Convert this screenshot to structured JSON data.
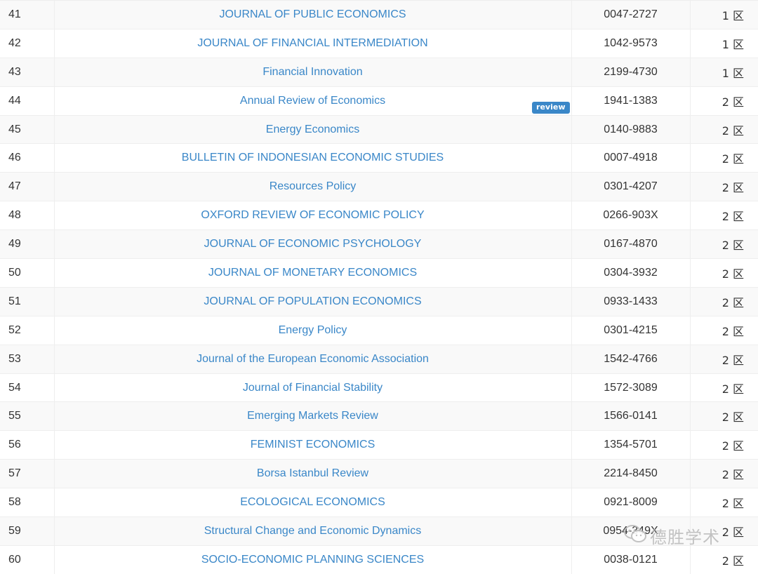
{
  "rows": [
    {
      "rank": "41",
      "name": "JOURNAL OF PUBLIC ECONOMICS",
      "issn": "0047-2727",
      "zone": "1 区"
    },
    {
      "rank": "42",
      "name": "JOURNAL OF FINANCIAL INTERMEDIATION",
      "issn": "1042-9573",
      "zone": "1 区"
    },
    {
      "rank": "43",
      "name": "Financial Innovation",
      "issn": "2199-4730",
      "zone": "1 区"
    },
    {
      "rank": "44",
      "name": "Annual Review of Economics",
      "issn": "1941-1383",
      "zone": "2 区",
      "badge": "review"
    },
    {
      "rank": "45",
      "name": "Energy Economics",
      "issn": "0140-9883",
      "zone": "2 区"
    },
    {
      "rank": "46",
      "name": "BULLETIN OF INDONESIAN ECONOMIC STUDIES",
      "issn": "0007-4918",
      "zone": "2 区"
    },
    {
      "rank": "47",
      "name": "Resources Policy",
      "issn": "0301-4207",
      "zone": "2 区"
    },
    {
      "rank": "48",
      "name": "OXFORD REVIEW OF ECONOMIC POLICY",
      "issn": "0266-903X",
      "zone": "2 区"
    },
    {
      "rank": "49",
      "name": "JOURNAL OF ECONOMIC PSYCHOLOGY",
      "issn": "0167-4870",
      "zone": "2 区"
    },
    {
      "rank": "50",
      "name": "JOURNAL OF MONETARY ECONOMICS",
      "issn": "0304-3932",
      "zone": "2 区"
    },
    {
      "rank": "51",
      "name": "JOURNAL OF POPULATION ECONOMICS",
      "issn": "0933-1433",
      "zone": "2 区"
    },
    {
      "rank": "52",
      "name": "Energy Policy",
      "issn": "0301-4215",
      "zone": "2 区"
    },
    {
      "rank": "53",
      "name": "Journal of the European Economic Association",
      "issn": "1542-4766",
      "zone": "2 区"
    },
    {
      "rank": "54",
      "name": "Journal of Financial Stability",
      "issn": "1572-3089",
      "zone": "2 区"
    },
    {
      "rank": "55",
      "name": "Emerging Markets Review",
      "issn": "1566-0141",
      "zone": "2 区"
    },
    {
      "rank": "56",
      "name": "FEMINIST ECONOMICS",
      "issn": "1354-5701",
      "zone": "2 区"
    },
    {
      "rank": "57",
      "name": "Borsa Istanbul Review",
      "issn": "2214-8450",
      "zone": "2 区"
    },
    {
      "rank": "58",
      "name": "ECOLOGICAL ECONOMICS",
      "issn": "0921-8009",
      "zone": "2 区"
    },
    {
      "rank": "59",
      "name": "Structural Change and Economic Dynamics",
      "issn": "0954-349X",
      "zone": "2 区"
    },
    {
      "rank": "60",
      "name": "SOCIO-ECONOMIC PLANNING SCIENCES",
      "issn": "0038-0121",
      "zone": "2 区"
    }
  ],
  "watermark": {
    "text": "德胜学术",
    "icon": "wechat-icon"
  },
  "colors": {
    "link": "#3a87c8",
    "stripe": "#f9f9f9",
    "badge": "#3a87c8"
  }
}
